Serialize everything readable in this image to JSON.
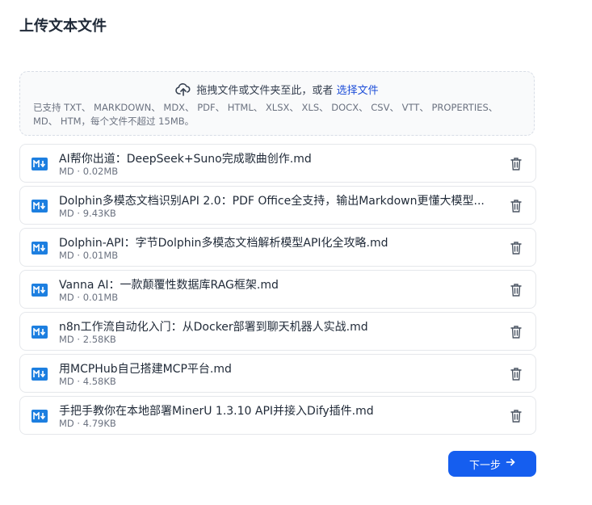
{
  "page": {
    "title": "上传文本文件"
  },
  "upload": {
    "prompt": "拖拽文件或文件夹至此，或者",
    "link_label": "选择文件",
    "supported": "已支持 TXT、 MARKDOWN、 MDX、 PDF、 HTML、 XLSX、 XLS、 DOCX、 CSV、 VTT、 PROPERTIES、 MD、 HTM，每个文件不超过 15MB。",
    "icon": "cloud-upload-icon"
  },
  "files": [
    {
      "name": "AI帮你出道：DeepSeek+Suno完成歌曲创作.md",
      "meta": "MD · 0.02MB"
    },
    {
      "name": "Dolphin多模态文档识别API 2.0：PDF Office全支持，输出Markdown更懂大模型...",
      "meta": "MD · 9.43KB"
    },
    {
      "name": "Dolphin-API：字节Dolphin多模态文档解析模型API化全攻略.md",
      "meta": "MD · 0.01MB"
    },
    {
      "name": "Vanna AI：一款颠覆性数据库RAG框架.md",
      "meta": "MD · 0.01MB"
    },
    {
      "name": "n8n工作流自动化入门：从Docker部署到聊天机器人实战.md",
      "meta": "MD · 2.58KB"
    },
    {
      "name": "用MCPHub自己搭建MCP平台.md",
      "meta": "MD · 4.58KB"
    },
    {
      "name": "手把手教你在本地部署MinerU 1.3.10 API并接入Dify插件.md",
      "meta": "MD · 4.79KB"
    }
  ],
  "actions": {
    "next_label": "下一步",
    "next_icon": "arrow-right-icon"
  },
  "colors": {
    "accent": "#155eef",
    "link": "#1d4ed8",
    "md_icon": "#1d7fe0"
  }
}
